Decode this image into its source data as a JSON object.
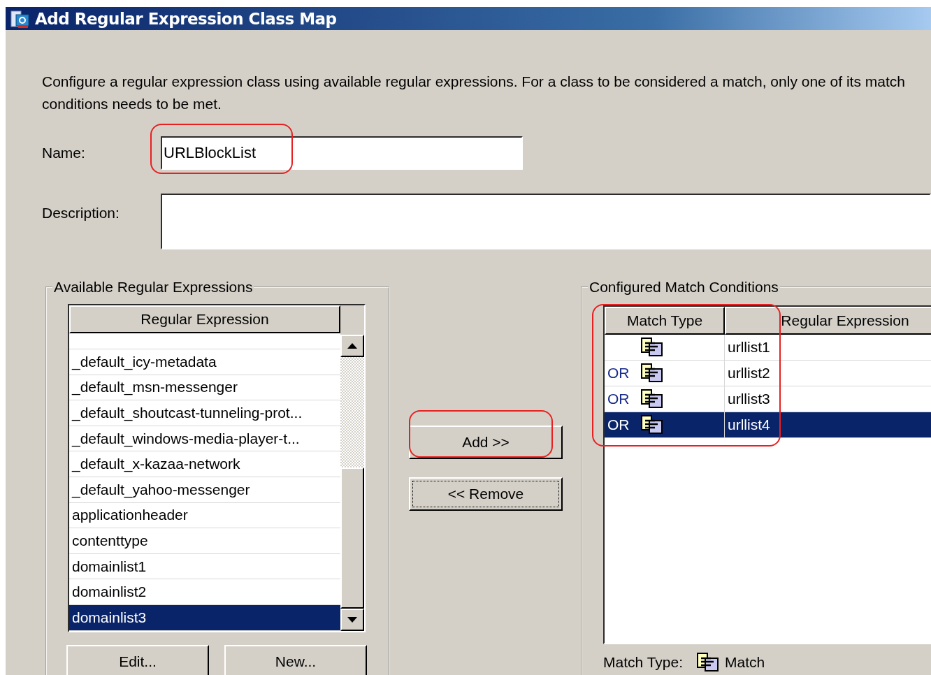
{
  "window": {
    "title": "Add Regular Expression Class Map"
  },
  "intro": "Configure a regular expression class using available regular expressions. For a class to be considered a match, only one of its match conditions needs to be met.",
  "name": {
    "label": "Name:",
    "value": "URLBlockList"
  },
  "description": {
    "label": "Description:"
  },
  "available": {
    "title": "Available Regular Expressions",
    "column": "Regular Expression",
    "items": [
      {
        "text": "_default_icy-metadata",
        "selected": false
      },
      {
        "text": "_default_msn-messenger",
        "selected": false
      },
      {
        "text": "_default_shoutcast-tunneling-prot...",
        "selected": false
      },
      {
        "text": "_default_windows-media-player-t...",
        "selected": false
      },
      {
        "text": "_default_x-kazaa-network",
        "selected": false
      },
      {
        "text": "_default_yahoo-messenger",
        "selected": false
      },
      {
        "text": "applicationheader",
        "selected": false
      },
      {
        "text": "contenttype",
        "selected": false
      },
      {
        "text": "domainlist1",
        "selected": false
      },
      {
        "text": "domainlist2",
        "selected": false
      },
      {
        "text": "domainlist3",
        "selected": true
      }
    ],
    "buttons": [
      "Edit...",
      "New..."
    ]
  },
  "actions": [
    {
      "label": "Add >>",
      "focused": false
    },
    {
      "label": "<< Remove",
      "focused": true
    }
  ],
  "conditions": {
    "title": "Configured Match Conditions",
    "columns": [
      "Match Type",
      "Regular Expression"
    ],
    "rows": [
      {
        "expression": "urllist1",
        "selected": false
      },
      {
        "operator": "OR",
        "expression": "urllist2",
        "selected": false
      },
      {
        "operator": "OR",
        "expression": "urllist3",
        "selected": false
      },
      {
        "operator": "OR",
        "expression": "urllist4",
        "selected": true
      }
    ]
  },
  "match_type": {
    "label": "Match Type:",
    "value": "Match"
  }
}
